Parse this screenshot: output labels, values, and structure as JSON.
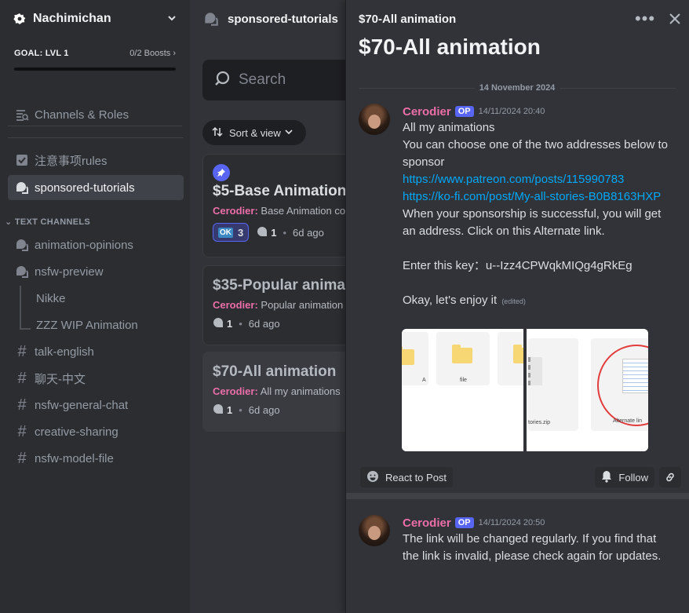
{
  "server": {
    "name": "Nachimichan"
  },
  "goal": {
    "label": "GOAL: LVL 1",
    "boosts": "0/2 Boosts"
  },
  "sidebar": {
    "items": [
      {
        "label": "Channels & Roles"
      },
      {
        "label": "注意事项rules"
      },
      {
        "label": "sponsored-tutorials"
      }
    ],
    "category": "TEXT CHANNELS",
    "channels": [
      {
        "label": "animation-opinions"
      },
      {
        "label": "nsfw-preview"
      },
      {
        "label": "Nikke"
      },
      {
        "label": "ZZZ WIP Animation"
      },
      {
        "label": "talk-english"
      },
      {
        "label": "聊天-中文"
      },
      {
        "label": "nsfw-general-chat"
      },
      {
        "label": "creative-sharing"
      },
      {
        "label": "nsfw-model-file"
      }
    ]
  },
  "forum": {
    "title": "sponsored-tutorials",
    "search_placeholder": "Search",
    "sort_label": "Sort & view",
    "posts": [
      {
        "title": "$5-Base Animation",
        "author": "Cerodier:",
        "preview": "Base Animation co",
        "reaction_count": "3",
        "replies": "1",
        "age": "6d ago"
      },
      {
        "title": "$35-Popular anima",
        "author": "Cerodier:",
        "preview": "Popular animation",
        "replies": "1",
        "age": "6d ago"
      },
      {
        "title": "$70-All animation",
        "author": "Cerodier:",
        "preview": "All my animations",
        "replies": "1",
        "age": "6d ago"
      }
    ]
  },
  "thread": {
    "header_title": "$70-All animation",
    "title": "$70-All animation",
    "date_divider": "14 November 2024",
    "messages": [
      {
        "author": "Cerodier",
        "badge": "OP",
        "time": "14/11/2024 20:40",
        "line1": "All my animations",
        "line2": "You can choose one of the two addresses below to sponsor",
        "link1": "https://www.patreon.com/posts/115990783",
        "link2": "https://ko-fi.com/post/My-all-stories-B0B8163HXP",
        "line3": "When your sponsorship is successful, you will get an address. Click on this Alternate link.",
        "line4": "Enter this key：u--Izz4CPWqkMIQg4gRkEg",
        "line5": "Okay, let's enjoy it",
        "edited": "(edited)"
      },
      {
        "author": "Cerodier",
        "badge": "OP",
        "time": "14/11/2024 20:50",
        "text": "The link will be changed regularly. If you find that the link is invalid, please check again for updates."
      }
    ],
    "attachment": {
      "folder_label_a": "A",
      "folder_label_b": "file",
      "zip_label": "tories.zip",
      "alt_label": "Alternate lin"
    },
    "react_label": "React to Post",
    "follow_label": "Follow"
  }
}
